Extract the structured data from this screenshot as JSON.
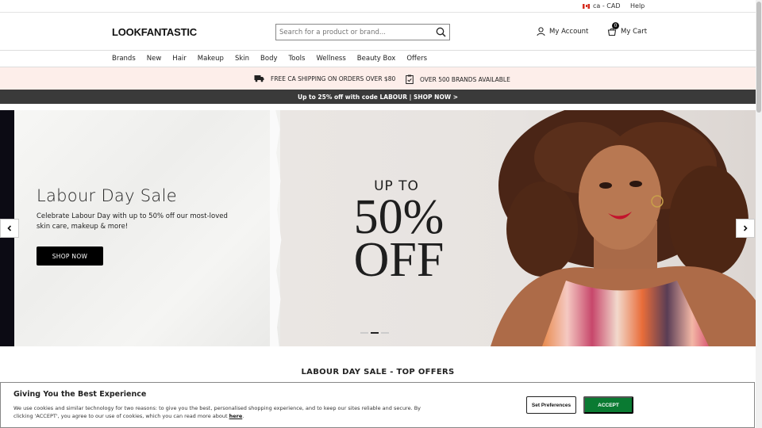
{
  "topbar": {
    "locale": "ca - CAD",
    "help": "Help"
  },
  "header": {
    "logo": "LOOKFANTASTIC",
    "search_placeholder": "Search for a product or brand...",
    "account": "My Account",
    "cart": "My Cart",
    "cart_count": "0"
  },
  "nav": {
    "items": [
      "Brands",
      "New",
      "Hair",
      "Makeup",
      "Skin",
      "Body",
      "Tools",
      "Wellness",
      "Beauty Box",
      "Offers"
    ]
  },
  "benefits": {
    "shipping": "FREE CA SHIPPING ON ORDERS OVER $80",
    "brands": "OVER 500 BRANDS AVAILABLE"
  },
  "promo": {
    "text": "Up to 25% off with code LABOUR | SHOP NOW >"
  },
  "hero": {
    "title": "Labour Day Sale",
    "description": "Celebrate Labour Day with up to 50% off our most-loved skin care, makeup & more!",
    "cta": "SHOP NOW",
    "offer_upto": "UP TO",
    "offer_pct": "50%",
    "offer_off": "OFF"
  },
  "section": {
    "title": "LABOUR DAY SALE - TOP OFFERS"
  },
  "cookie": {
    "title": "Giving You the Best Experience",
    "body": "We use cookies and similar technology for two reasons: to give you the best, personalised shopping experience, and to keep our sites reliable and secure. By clicking 'ACCEPT', you agree to our use of cookies, which you can read more about ",
    "link": "here",
    "period": ".",
    "prefs": "Set Preferences",
    "accept": "ACCEPT"
  },
  "colors": {
    "benefit_bg": "#fdeeea",
    "promo_bg": "#3a3a3a",
    "accept_bg": "#0a7a32"
  }
}
